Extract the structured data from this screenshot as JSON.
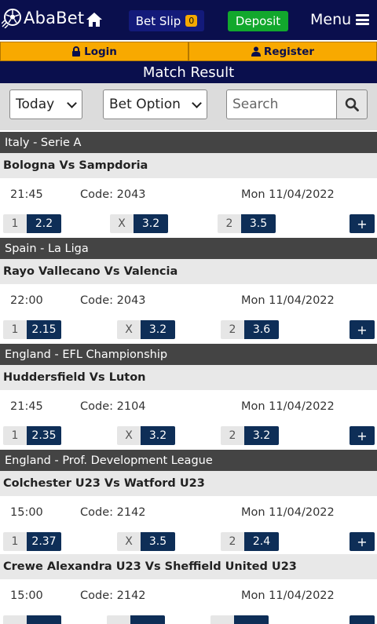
{
  "brand": {
    "name": "AbaBet"
  },
  "header": {
    "betslip_label": "Bet Slip",
    "betslip_count": "0",
    "deposit_label": "Deposit",
    "menu_label": "Menu"
  },
  "auth": {
    "login_label": "Login",
    "register_label": "Register"
  },
  "page_title": "Match Result",
  "filters": {
    "date_value": "Today",
    "bet_option_value": "Bet Option",
    "search_placeholder": "Search"
  },
  "colors": {
    "navy": "#0a0f4d",
    "orange": "#f8a900",
    "green": "#12a82d",
    "odds_blue": "#0e2e57",
    "league_bar": "#444444"
  },
  "events": [
    {
      "league": "Italy - Serie A",
      "match": "Bologna Vs Sampdoria",
      "time": "21:45",
      "code": "Code: 2043",
      "date": "Mon 11/04/2022",
      "odds": [
        {
          "label": "1",
          "value": "2.2"
        },
        {
          "label": "X",
          "value": "3.2"
        },
        {
          "label": "2",
          "value": "3.5"
        }
      ],
      "more": "+"
    },
    {
      "league": "Spain - La Liga",
      "match": "Rayo Vallecano Vs Valencia",
      "time": "22:00",
      "code": "Code: 2043",
      "date": "Mon 11/04/2022",
      "odds": [
        {
          "label": "1",
          "value": "2.15"
        },
        {
          "label": "X",
          "value": "3.2"
        },
        {
          "label": "2",
          "value": "3.6"
        }
      ],
      "more": "+"
    },
    {
      "league": "England - EFL Championship",
      "match": "Huddersfield Vs Luton",
      "time": "21:45",
      "code": "Code: 2104",
      "date": "Mon 11/04/2022",
      "odds": [
        {
          "label": "1",
          "value": "2.35"
        },
        {
          "label": "X",
          "value": "3.2"
        },
        {
          "label": "2",
          "value": "3.2"
        }
      ],
      "more": "+"
    },
    {
      "league": "England - Prof. Development League",
      "match": "Colchester U23 Vs Watford U23",
      "time": "15:00",
      "code": "Code: 2142",
      "date": "Mon 11/04/2022",
      "odds": [
        {
          "label": "1",
          "value": "2.37"
        },
        {
          "label": "X",
          "value": "3.5"
        },
        {
          "label": "2",
          "value": "2.4"
        }
      ],
      "more": "+"
    },
    {
      "league": "",
      "match": "Crewe Alexandra U23 Vs Sheffield United U23",
      "time": "15:00",
      "code": "Code: 2142",
      "date": "Mon 11/04/2022",
      "odds": [
        {
          "label": "",
          "value": ""
        },
        {
          "label": "",
          "value": ""
        },
        {
          "label": "",
          "value": ""
        }
      ],
      "more": ""
    }
  ]
}
